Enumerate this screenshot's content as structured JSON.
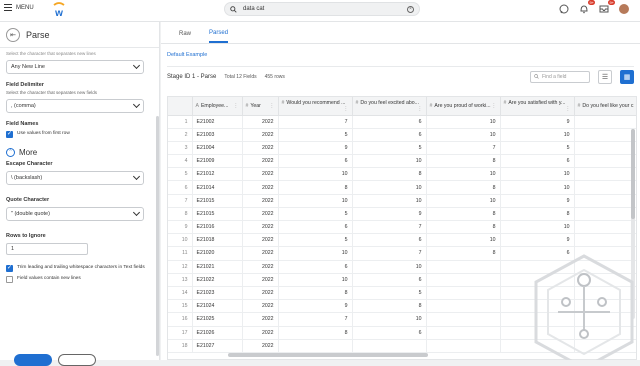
{
  "topbar": {
    "menu_label": "MENU",
    "search_value": "data cat",
    "badges": {
      "notifications": "9+",
      "inbox": "9+"
    }
  },
  "left_panel": {
    "title": "Parse",
    "cut_label": "Select the character that separates new lines",
    "line_separator_value": "Any New Line",
    "field_delimiter_label": "Field Delimiter",
    "field_delimiter_sub": "Select the character that separates new fields",
    "field_delimiter_value": ", (comma)",
    "field_names_label": "Field Names",
    "use_first_row_label": "Use values from first row",
    "more_label": "More",
    "escape_label": "Escape Character",
    "escape_value": "\\ (backslash)",
    "quote_label": "Quote Character",
    "quote_value": "\" (double quote)",
    "rows_ignore_label": "Rows to Ignore",
    "rows_ignore_value": "1",
    "trim_label": "Trim leading and trailing whitespace characters in Text fields",
    "newlines_label": "Field values contain new lines"
  },
  "main": {
    "tabs": [
      {
        "label": "Raw"
      },
      {
        "label": "Parsed"
      }
    ],
    "default_example": "Default Example",
    "stage_title": "Stage ID 1 - Parse",
    "total_fields": "Total 12 Fields",
    "row_count": "455 rows",
    "find_placeholder": "Find a field"
  },
  "table": {
    "columns": [
      {
        "icon": "A",
        "label": "Employee..."
      },
      {
        "icon": "#",
        "label": "Year"
      },
      {
        "icon": "#",
        "label": "Would you recommend ..."
      },
      {
        "icon": "#",
        "label": "Do you feel excited abo..."
      },
      {
        "icon": "#",
        "label": "Are you proud of worki..."
      },
      {
        "icon": "#",
        "label": "Are you satisfied with y..."
      },
      {
        "icon": "#",
        "label": "Do you feel like your c"
      }
    ],
    "rows": [
      {
        "n": "1",
        "cells": [
          "E21002",
          "2022",
          "7",
          "6",
          "10",
          "9",
          ""
        ]
      },
      {
        "n": "2",
        "cells": [
          "E21003",
          "2022",
          "5",
          "6",
          "10",
          "10",
          ""
        ]
      },
      {
        "n": "3",
        "cells": [
          "E21004",
          "2022",
          "9",
          "5",
          "7",
          "5",
          ""
        ]
      },
      {
        "n": "4",
        "cells": [
          "E21009",
          "2022",
          "6",
          "10",
          "8",
          "6",
          ""
        ]
      },
      {
        "n": "5",
        "cells": [
          "E21012",
          "2022",
          "10",
          "8",
          "10",
          "10",
          ""
        ]
      },
      {
        "n": "6",
        "cells": [
          "E21014",
          "2022",
          "8",
          "10",
          "8",
          "10",
          ""
        ]
      },
      {
        "n": "7",
        "cells": [
          "E21015",
          "2022",
          "10",
          "10",
          "10",
          "9",
          ""
        ]
      },
      {
        "n": "8",
        "cells": [
          "E21015",
          "2022",
          "5",
          "9",
          "8",
          "8",
          ""
        ]
      },
      {
        "n": "9",
        "cells": [
          "E21016",
          "2022",
          "6",
          "7",
          "8",
          "10",
          ""
        ]
      },
      {
        "n": "10",
        "cells": [
          "E21018",
          "2022",
          "5",
          "6",
          "10",
          "9",
          ""
        ]
      },
      {
        "n": "11",
        "cells": [
          "E21020",
          "2022",
          "10",
          "7",
          "8",
          "6",
          ""
        ]
      },
      {
        "n": "12",
        "cells": [
          "E21021",
          "2022",
          "6",
          "10",
          "",
          "",
          ""
        ]
      },
      {
        "n": "13",
        "cells": [
          "E21022",
          "2022",
          "10",
          "6",
          "",
          "",
          ""
        ]
      },
      {
        "n": "14",
        "cells": [
          "E21023",
          "2022",
          "8",
          "5",
          "",
          "",
          ""
        ]
      },
      {
        "n": "15",
        "cells": [
          "E21024",
          "2022",
          "9",
          "8",
          "",
          "",
          ""
        ]
      },
      {
        "n": "16",
        "cells": [
          "E21025",
          "2022",
          "7",
          "10",
          "",
          "",
          ""
        ]
      },
      {
        "n": "17",
        "cells": [
          "E21026",
          "2022",
          "8",
          "6",
          "",
          "",
          ""
        ]
      },
      {
        "n": "18",
        "cells": [
          "E21027",
          "2022",
          "",
          "",
          "",
          "",
          ""
        ]
      }
    ]
  }
}
